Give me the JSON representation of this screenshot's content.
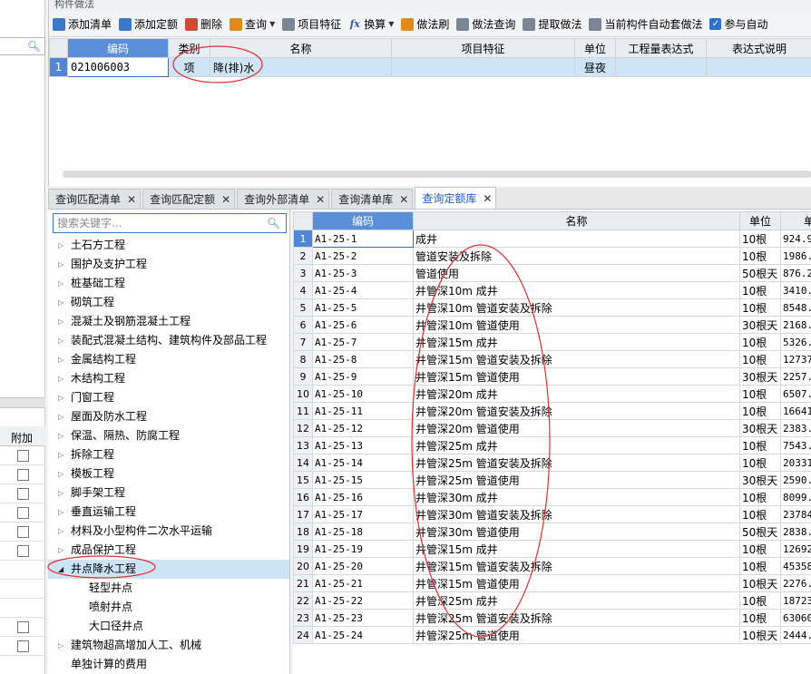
{
  "left_strip": {
    "addon_header": "附加",
    "addon_rows": 6,
    "addon_rows_bottom": 2
  },
  "top_panel": {
    "title": "构件做法",
    "toolbar": [
      {
        "name": "add-list-button",
        "label": "添加清单",
        "icon": "add-list-icon",
        "color": "blue"
      },
      {
        "name": "add-quota-button",
        "label": "添加定额",
        "icon": "add-quota-icon",
        "color": "blue"
      },
      {
        "name": "delete-button",
        "label": "删除",
        "icon": "delete-icon",
        "color": "red"
      },
      {
        "name": "query-button",
        "label": "查询",
        "icon": "query-icon",
        "color": "orange",
        "dropdown": true
      },
      {
        "name": "item-feature-button",
        "label": "项目特征",
        "icon": "feature-icon",
        "color": "gray"
      },
      {
        "name": "convert-button",
        "label": "换算",
        "icon": "fx-icon",
        "color": "fx",
        "dropdown": true
      },
      {
        "name": "method-brush-button",
        "label": "做法刷",
        "icon": "brush-icon",
        "color": "orange"
      },
      {
        "name": "method-query-button",
        "label": "做法查询",
        "icon": "method-query-icon",
        "color": "gray"
      },
      {
        "name": "extract-method-button",
        "label": "提取做法",
        "icon": "extract-icon",
        "color": "gray"
      },
      {
        "name": "auto-apply-button",
        "label": "当前构件自动套做法",
        "icon": "auto-apply-icon",
        "color": "gray"
      },
      {
        "name": "participate-checkbox",
        "label": "参与自动",
        "icon": "checkbox-icon",
        "color": "check"
      }
    ],
    "columns": {
      "code": "编码",
      "category": "类别",
      "name": "名称",
      "feature": "项目特征",
      "unit": "单位",
      "expression": "工程量表达式",
      "expr_desc": "表达式说明"
    },
    "row": {
      "index": "1",
      "code": "021006003",
      "category": "项",
      "name": "降(排)水",
      "feature": "",
      "unit": "昼夜",
      "expression": "",
      "expr_desc": ""
    }
  },
  "tabs": [
    {
      "label": "查询匹配清单",
      "active": false
    },
    {
      "label": "查询匹配定额",
      "active": false
    },
    {
      "label": "查询外部清单",
      "active": false
    },
    {
      "label": "查询清单库",
      "active": false
    },
    {
      "label": "查询定额库",
      "active": true
    }
  ],
  "tree": {
    "search_placeholder": "搜索关键字...",
    "items": [
      {
        "label": "土石方工程",
        "type": "collapsed"
      },
      {
        "label": "围护及支护工程",
        "type": "collapsed"
      },
      {
        "label": "桩基础工程",
        "type": "collapsed"
      },
      {
        "label": "砌筑工程",
        "type": "collapsed"
      },
      {
        "label": "混凝土及钢筋混凝土工程",
        "type": "collapsed"
      },
      {
        "label": "装配式混凝土结构、建筑构件及部品工程",
        "type": "collapsed"
      },
      {
        "label": "金属结构工程",
        "type": "collapsed"
      },
      {
        "label": "木结构工程",
        "type": "collapsed"
      },
      {
        "label": "门窗工程",
        "type": "collapsed"
      },
      {
        "label": "屋面及防水工程",
        "type": "collapsed"
      },
      {
        "label": "保温、隔热、防腐工程",
        "type": "collapsed"
      },
      {
        "label": "拆除工程",
        "type": "collapsed"
      },
      {
        "label": "模板工程",
        "type": "collapsed"
      },
      {
        "label": "脚手架工程",
        "type": "collapsed"
      },
      {
        "label": "垂直运输工程",
        "type": "collapsed"
      },
      {
        "label": "材料及小型构件二次水平运输",
        "type": "collapsed"
      },
      {
        "label": "成品保护工程",
        "type": "collapsed"
      },
      {
        "label": "井点降水工程",
        "type": "expanded",
        "selected": true
      },
      {
        "label": "轻型井点",
        "type": "child"
      },
      {
        "label": "喷射井点",
        "type": "child"
      },
      {
        "label": "大口径井点",
        "type": "child"
      },
      {
        "label": "建筑物超高增加人工、机械",
        "type": "collapsed"
      },
      {
        "label": "单独计算的费用",
        "type": "plain"
      }
    ]
  },
  "quota": {
    "columns": {
      "code": "编码",
      "name": "名称",
      "unit": "单位",
      "price": "单"
    },
    "rows": [
      {
        "code": "A1-25-1",
        "name": "成井",
        "unit": "10根",
        "price": "924.9"
      },
      {
        "code": "A1-25-2",
        "name": "管道安装及拆除",
        "unit": "10根",
        "price": "1986."
      },
      {
        "code": "A1-25-3",
        "name": "管道使用",
        "unit": "50根天",
        "price": "876.2"
      },
      {
        "code": "A1-25-4",
        "name": "井管深10m 成井",
        "unit": "10根",
        "price": "3410."
      },
      {
        "code": "A1-25-5",
        "name": "井管深10m 管道安装及拆除",
        "unit": "10根",
        "price": "8548."
      },
      {
        "code": "A1-25-6",
        "name": "井管深10m 管道使用",
        "unit": "30根天",
        "price": "2168."
      },
      {
        "code": "A1-25-7",
        "name": "井管深15m 成井",
        "unit": "10根",
        "price": "5326."
      },
      {
        "code": "A1-25-8",
        "name": "井管深15m 管道安装及拆除",
        "unit": "10根",
        "price": "12737"
      },
      {
        "code": "A1-25-9",
        "name": "井管深15m 管道使用",
        "unit": "30根天",
        "price": "2257."
      },
      {
        "code": "A1-25-10",
        "name": "井管深20m 成井",
        "unit": "10根",
        "price": "6507."
      },
      {
        "code": "A1-25-11",
        "name": "井管深20m 管道安装及拆除",
        "unit": "10根",
        "price": "16641"
      },
      {
        "code": "A1-25-12",
        "name": "井管深20m 管道使用",
        "unit": "30根天",
        "price": "2383."
      },
      {
        "code": "A1-25-13",
        "name": "井管深25m 成井",
        "unit": "10根",
        "price": "7543."
      },
      {
        "code": "A1-25-14",
        "name": "井管深25m 管道安装及拆除",
        "unit": "10根",
        "price": "20331"
      },
      {
        "code": "A1-25-15",
        "name": "井管深25m 管道使用",
        "unit": "30根天",
        "price": "2590."
      },
      {
        "code": "A1-25-16",
        "name": "井管深30m 成井",
        "unit": "10根",
        "price": "8099."
      },
      {
        "code": "A1-25-17",
        "name": "井管深30m 管道安装及拆除",
        "unit": "10根",
        "price": "23784"
      },
      {
        "code": "A1-25-18",
        "name": "井管深30m 管道使用",
        "unit": "50根天",
        "price": "2838."
      },
      {
        "code": "A1-25-19",
        "name": "井管深15m 成井",
        "unit": "10根",
        "price": "12692"
      },
      {
        "code": "A1-25-20",
        "name": "井管深15m 管道安装及拆除",
        "unit": "10根",
        "price": "45358"
      },
      {
        "code": "A1-25-21",
        "name": "井管深15m 管道使用",
        "unit": "10根天",
        "price": "2276."
      },
      {
        "code": "A1-25-22",
        "name": "井管深25m 成井",
        "unit": "10根",
        "price": "18723"
      },
      {
        "code": "A1-25-23",
        "name": "井管深25m 管道安装及拆除",
        "unit": "10根",
        "price": "63060"
      },
      {
        "code": "A1-25-24",
        "name": "井管深25m 管道使用",
        "unit": "10根天",
        "price": "2444."
      }
    ]
  },
  "colors": {
    "selection_blue": "#4f86d6",
    "row_highlight": "#cde5f7",
    "annotation_red": "#e03030",
    "active_tab_text": "#1d5bbf"
  }
}
